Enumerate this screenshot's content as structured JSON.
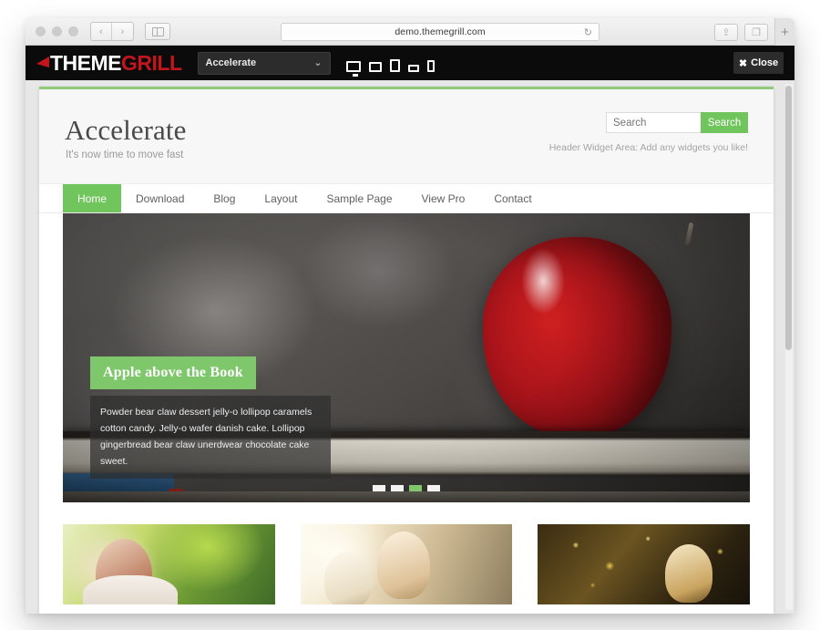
{
  "browser": {
    "url": "demo.themegrill.com",
    "reload_icon": "reload-icon",
    "back_arrow": "‹",
    "forward_arrow": "›",
    "sidebar_icon": "sidebar-icon",
    "share_icon": "⇪",
    "tabs_icon": "❐",
    "new_tab_label": "+",
    "traffic_lights": [
      "close",
      "minimize",
      "maximize"
    ]
  },
  "customizer": {
    "logo": {
      "theme_part": "THEME",
      "grill_part": "GRILL",
      "flame_icon": "flame-icon"
    },
    "theme_select": {
      "value": "Accelerate",
      "chevron": "⌄"
    },
    "devices": [
      {
        "name": "desktop",
        "icon": "desktop-icon"
      },
      {
        "name": "laptop",
        "icon": "laptop-icon"
      },
      {
        "name": "tablet-portrait",
        "icon": "tablet-portrait-icon"
      },
      {
        "name": "tablet-landscape",
        "icon": "tablet-landscape-icon"
      },
      {
        "name": "phone",
        "icon": "phone-icon"
      }
    ],
    "close": {
      "label": "Close",
      "icon": "✖"
    }
  },
  "site": {
    "title": "Accelerate",
    "tagline": "It's now time to move fast",
    "search": {
      "placeholder": "Search",
      "value": "",
      "button_label": "Search"
    },
    "widget_note": "Header Widget Area: Add any widgets you like!",
    "nav": [
      {
        "label": "Home",
        "active": true
      },
      {
        "label": "Download",
        "active": false
      },
      {
        "label": "Blog",
        "active": false
      },
      {
        "label": "Layout",
        "active": false
      },
      {
        "label": "Sample Page",
        "active": false
      },
      {
        "label": "View Pro",
        "active": false
      },
      {
        "label": "Contact",
        "active": false
      }
    ],
    "slider": {
      "caption_title": "Apple above the Book",
      "caption_body": "Powder bear claw dessert jelly-o lollipop caramels cotton candy. Jelly-o wafer danish cake. Lollipop gingerbread bear claw unerdwear chocolate cake sweet.",
      "pager": {
        "total": 4,
        "active_index": 2
      }
    },
    "features": [
      {
        "name": "feature-image-1"
      },
      {
        "name": "feature-image-2"
      },
      {
        "name": "feature-image-3"
      }
    ]
  },
  "colors": {
    "accent_green": "#71c55d",
    "slider_caption_green": "#7ec76a",
    "brand_red": "#c3161c",
    "customizer_bar": "#0b0b0b",
    "preview_bg": "#e7e7e7"
  }
}
